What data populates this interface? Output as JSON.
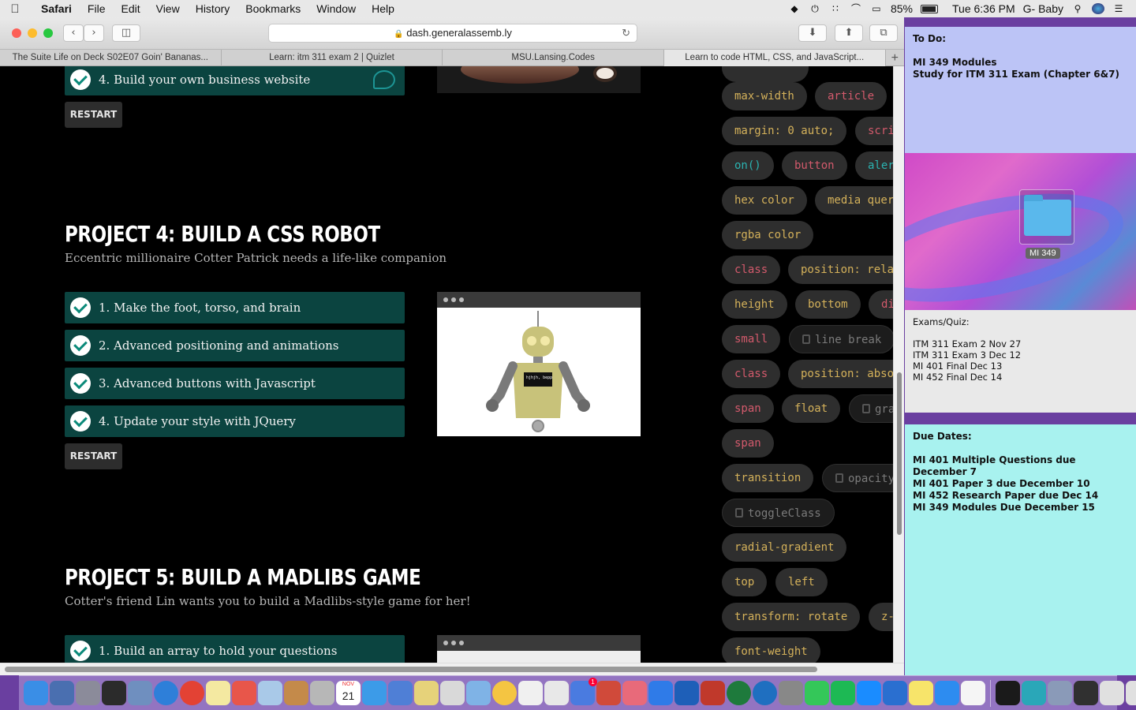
{
  "menubar": {
    "app_name": "Safari",
    "menus": [
      "File",
      "Edit",
      "View",
      "History",
      "Bookmarks",
      "Window",
      "Help"
    ],
    "battery": "85%",
    "clock": "Tue 6:36 PM",
    "user": "G- Baby"
  },
  "browser": {
    "url": "dash.generalassemb.ly",
    "tabs": [
      "The Suite Life on Deck S02E07 Goin' Bananas...",
      "Learn: itm 311 exam 2 | Quizlet",
      "MSU.Lansing.Codes",
      "Learn to code HTML, CSS, and JavaScript..."
    ],
    "new_tab": "+"
  },
  "page": {
    "project3_last_step": "4. Build your own business website",
    "restart_label": "RESTART",
    "project4": {
      "title": "PROJECT 4: BUILD A CSS ROBOT",
      "subtitle": "Eccentric millionaire Cotter Patrick needs a life-like companion",
      "steps": [
        "1. Make the foot, torso, and brain",
        "2. Advanced positioning and animations",
        "3. Advanced buttons with Javascript",
        "4. Update your style with JQuery"
      ],
      "robot_screen_text": "hjhjh, bepp"
    },
    "project5": {
      "title": "PROJECT 5: BUILD A MADLIBS GAME",
      "subtitle": "Cotter's friend Lin wants you to build a Madlibs-style game for her!",
      "steps": [
        "1. Build an array to hold your questions"
      ]
    },
    "tags": [
      "max-width",
      "article",
      "margin: 0 auto;",
      "scri",
      "on()",
      "button",
      "aler",
      "hex color",
      "media quer",
      "rgba color",
      "class",
      "position: rela",
      "height",
      "bottom",
      "di",
      "small",
      "line break",
      "class",
      "position: abso",
      "span",
      "float",
      "gra",
      "span",
      "transition",
      "opacity",
      "toggleClass",
      "radial-gradient",
      "top",
      "left",
      "transform: rotate",
      "z-",
      "font-weight"
    ]
  },
  "stickies": {
    "todo": {
      "title": "To Do:",
      "items": [
        "MI 349 Modules",
        "Study for ITM 311 Exam (Chapter 6&7)"
      ]
    },
    "exams": {
      "title": "Exams/Quiz:",
      "items": [
        "ITM  311 Exam 2 Nov 27",
        "ITM  311 Exam 3 Dec 12",
        "MI 401 Final Dec 13",
        "MI 452 Final Dec 14"
      ]
    },
    "due": {
      "title": "Due Dates:",
      "items": [
        "MI 401 Multiple Questions due December 7",
        "MI 401 Paper 3 due December 10",
        "MI 452 Research Paper due Dec 14",
        "MI 349 Modules Due December 15"
      ]
    }
  },
  "desktop": {
    "folder_label": "MI 349"
  },
  "dock": {
    "calendar_month": "NOV",
    "calendar_day": "21",
    "appstore_badge": "1",
    "icon_colors": [
      "#3a8ee6",
      "#4a6fb0",
      "#8b8b9a",
      "#2b2b2b",
      "#6f8fbf",
      "#2e7fd9",
      "#e34234",
      "#f4e9a1",
      "#e8564a",
      "#a9c9e8",
      "#c48a4a",
      "#b7b7b7",
      "#f0f0f0",
      "#3c9be8",
      "#4f7fd6",
      "#e6d27a",
      "#d9d9d9",
      "#7fb3e6",
      "#f4c542",
      "#f0f0f0",
      "#e8e8e8",
      "#4a7be0",
      "#d04a3a",
      "#e86a7a",
      "#2f7be8",
      "#1e5fb8",
      "#c0392b",
      "#1e7a3c",
      "#1f6fc0",
      "#888",
      "#34c759",
      "#1db954",
      "#1a8cff",
      "#2a6fd0",
      "#f7e46a",
      "#2d8cf0",
      "#f5f5f5",
      "#1a1a1a",
      "#2aa7b8",
      "#8a9ab8",
      "#303030",
      "#e0e0e0",
      "#e0e0e0",
      "#e0e0e0",
      "#3b2f2f",
      "#c8c8c8"
    ]
  }
}
